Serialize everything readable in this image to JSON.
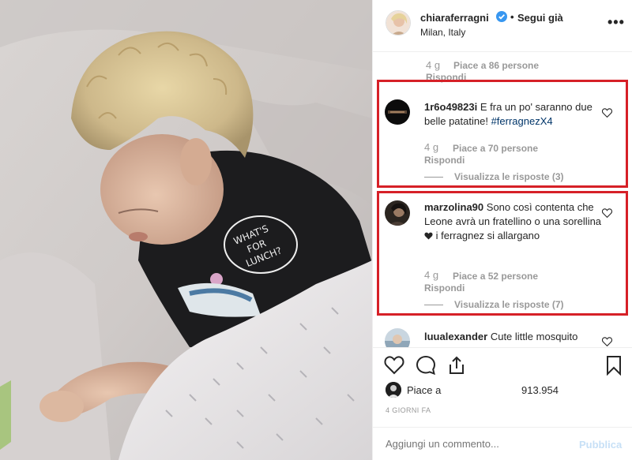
{
  "post": {
    "author": "chiaraferragni",
    "separator": "•",
    "follow_label": "Segui già",
    "location": "Milan, Italy",
    "more_label": "•••",
    "photo_shirt_text": [
      "WHAT'S",
      "FOR",
      "LUNCH?"
    ]
  },
  "comments": [
    {
      "user": "",
      "text": "",
      "age": "4 g",
      "likes": "Piace a 86 persone",
      "reply": "Rispondi"
    },
    {
      "user": "1r6o49823i",
      "text": "E fra un po' saranno due belle patatine!",
      "hashtag": "#ferragnezX4",
      "age": "4 g",
      "likes": "Piace a 70 persone",
      "reply": "Rispondi",
      "view_replies": "Visualizza le risposte (3)"
    },
    {
      "user": "marzolina90",
      "text_before": "Sono così contenta che Leone avrà un fratellino o una sorellina",
      "text_after": "i ferragnez si allargano",
      "age": "4 g",
      "likes": "Piace a 52 persone",
      "reply": "Rispondi",
      "view_replies": "Visualizza le risposte (7)"
    },
    {
      "user": "luualexander",
      "text": "Cute little mosquito"
    }
  ],
  "actions": {
    "likes_label": "Piace a",
    "likes_count": "913.954",
    "time_ago": "4 GIORNI FA",
    "comment_placeholder": "Aggiungi un commento...",
    "publish_label": "Pubblica"
  },
  "colors": {
    "highlight_box": "#d62027",
    "verified_badge": "#3897f0",
    "hashtag": "#003569",
    "muted": "#999999"
  }
}
